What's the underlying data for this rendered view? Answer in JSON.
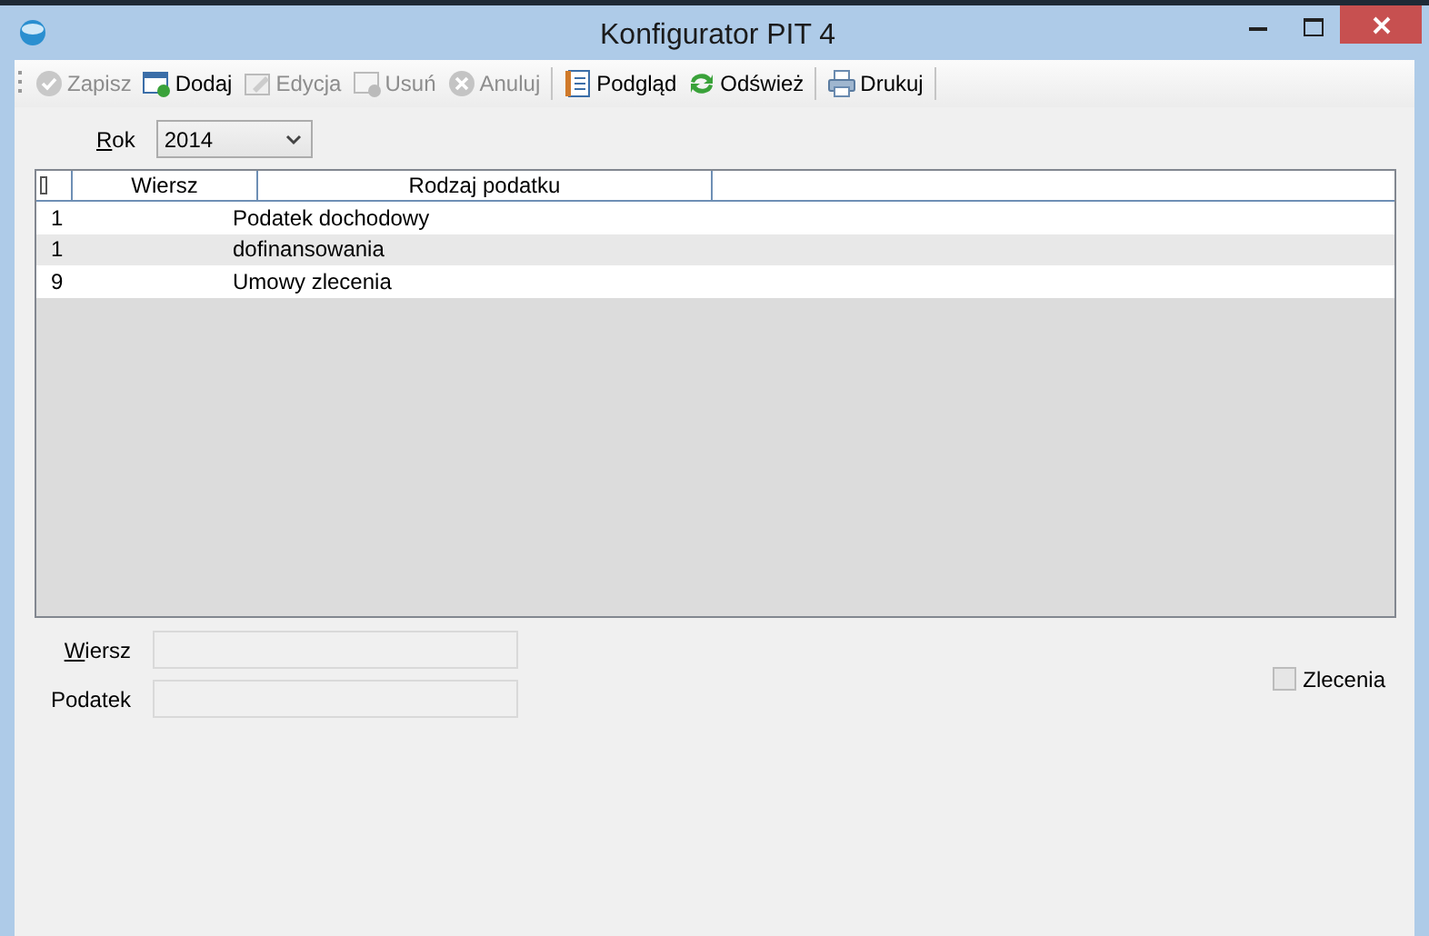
{
  "window": {
    "title": "Konfigurator PIT 4"
  },
  "toolbar": [
    {
      "kind": "button",
      "label": "Zapisz",
      "disabled": true
    },
    {
      "kind": "button",
      "label": "Dodaj",
      "disabled": false
    },
    {
      "kind": "button",
      "label": "Edycja",
      "disabled": true
    },
    {
      "kind": "button",
      "label": "Usuń",
      "disabled": true
    },
    {
      "kind": "button",
      "label": "Anuluj",
      "disabled": true
    },
    {
      "kind": "separator"
    },
    {
      "kind": "button",
      "label": "Podgląd",
      "disabled": false
    },
    {
      "kind": "button",
      "label": "Odśwież",
      "disabled": false
    },
    {
      "kind": "separator"
    },
    {
      "kind": "button",
      "label": "Drukuj",
      "disabled": false
    },
    {
      "kind": "separator"
    }
  ],
  "year": {
    "label": "Rok",
    "underline_first": true,
    "value": "2014"
  },
  "table": {
    "columns": [
      "Wiersz",
      "Rodzaj podatku"
    ],
    "rows": [
      {
        "cells": [
          "1",
          "Podatek dochodowy"
        ]
      },
      {
        "cells": [
          "1",
          "dofinansowania"
        ]
      },
      {
        "cells": [
          "9",
          "Umowy zlecenia"
        ]
      }
    ]
  },
  "form": {
    "fields": [
      {
        "label": "Wiersz",
        "underline_first": true
      },
      {
        "label": "Podatek",
        "underline_first": false
      }
    ],
    "checkbox": {
      "label": "Zlecenia",
      "checked": false
    }
  }
}
